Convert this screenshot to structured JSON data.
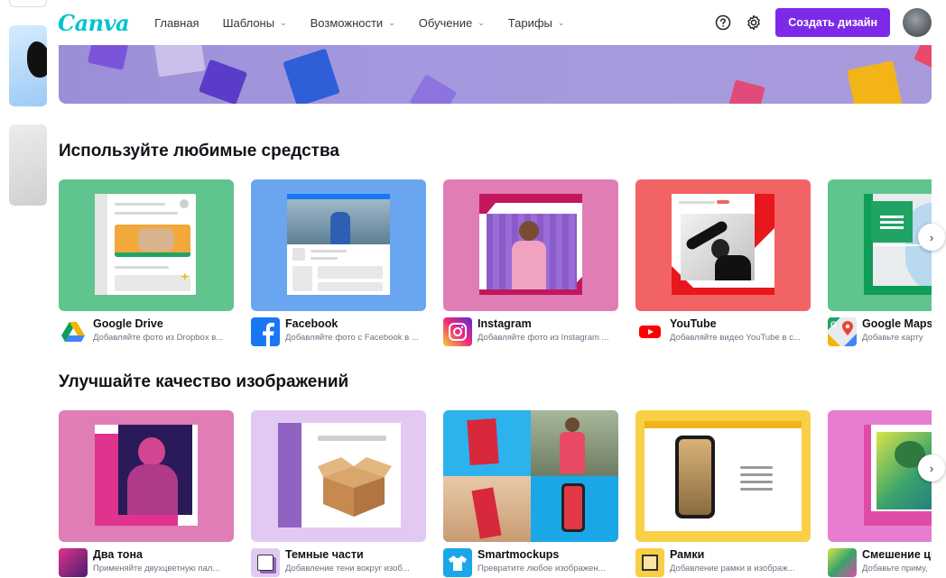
{
  "header": {
    "logo": "Canva",
    "nav": [
      {
        "label": "Главная",
        "has_dropdown": false
      },
      {
        "label": "Шаблоны",
        "has_dropdown": true
      },
      {
        "label": "Возможности",
        "has_dropdown": true
      },
      {
        "label": "Обучение",
        "has_dropdown": true
      },
      {
        "label": "Тарифы",
        "has_dropdown": true
      }
    ],
    "create_button": "Создать дизайн",
    "help_icon": "question-circle-icon",
    "settings_icon": "gear-icon",
    "chevron_glyph": "⌄"
  },
  "sections": [
    {
      "title": "Используйте любимые средства",
      "cards": [
        {
          "title": "Google Drive",
          "desc": "Добавляйте фото из Dropbox в...",
          "icon": "google-drive-icon",
          "bg": "#5fc48e"
        },
        {
          "title": "Facebook",
          "desc": "Добавляйте фото с Facebook в ...",
          "icon": "facebook-icon",
          "bg": "#6aa6f0"
        },
        {
          "title": "Instagram",
          "desc": "Добавляйте фото из Instagram ...",
          "icon": "instagram-icon",
          "bg": "#e07db5"
        },
        {
          "title": "YouTube",
          "desc": "Добавляйте видео YouTube в с...",
          "icon": "youtube-icon",
          "bg": "#f26366"
        },
        {
          "title": "Google Maps",
          "desc": "Добавьте карту",
          "icon": "google-maps-icon",
          "bg": "#5fc48e"
        }
      ]
    },
    {
      "title": "Улучшайте качество изображений",
      "cards": [
        {
          "title": "Два тона",
          "desc": "Применяйте двухцветную пал...",
          "icon": "duotone-icon",
          "bg": "#e07db5"
        },
        {
          "title": "Темные части",
          "desc": "Добавление тени вокруг изоб...",
          "icon": "shadows-icon",
          "bg": "#e2c9f2"
        },
        {
          "title": "Smartmockups",
          "desc": "Превратите любое изображен...",
          "icon": "smartmockups-icon",
          "bg": "#1aa7e8"
        },
        {
          "title": "Рамки",
          "desc": "Добавление рамки в изображ...",
          "icon": "frames-icon",
          "bg": "#f9cf45"
        },
        {
          "title": "Смешение цв",
          "desc": "Добавьте приму,",
          "icon": "color-mix-icon",
          "bg": "#e77dd0"
        }
      ]
    }
  ],
  "next_glyph": "›"
}
